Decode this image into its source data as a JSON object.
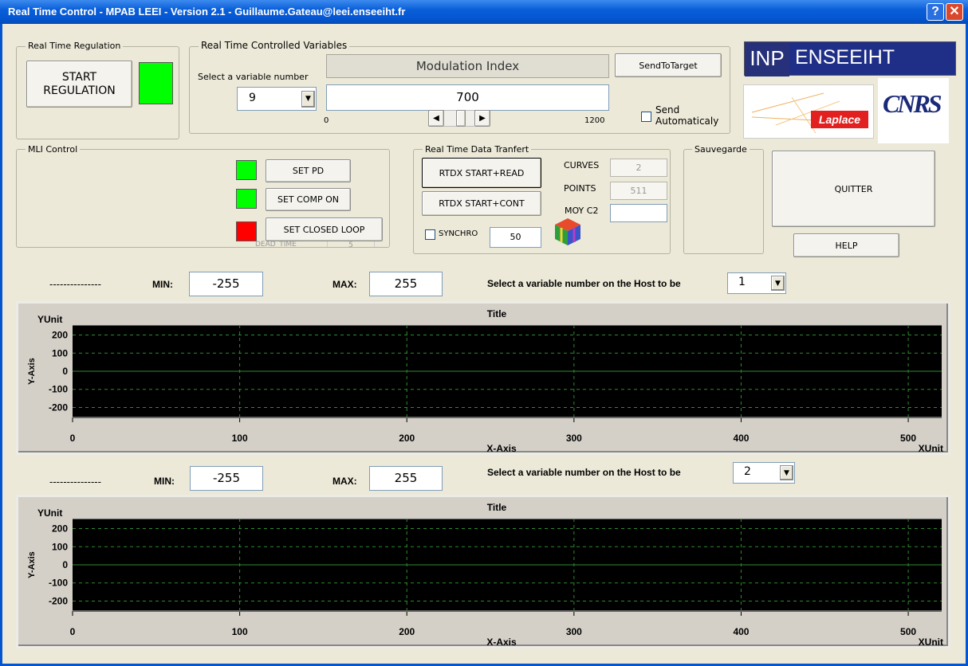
{
  "window": {
    "title": "Real Time Control - MPAB LEEI - Version 2.1 - Guillaume.Gateau@leei.enseeiht.fr",
    "help_glyph": "?",
    "close_glyph": "✕"
  },
  "regulation": {
    "group_title": "Real Time Regulation",
    "start_button": "START\nREGULATION",
    "led_color": "#00ff00"
  },
  "controlled": {
    "group_title": "Real Time Controlled Variables",
    "select_label": "Select a variable number",
    "variable_number": "9",
    "variable_name": "Modulation Index",
    "value": "700",
    "send_button": "SendToTarget",
    "slider_min": "0",
    "slider_max": "1200",
    "slider_value": 700,
    "auto_send_label": "Send\nAutomaticaly",
    "auto_send_checked": false
  },
  "logos": {
    "inp": "INP",
    "enseeiht": "ENSEEIHT",
    "laplace": "Laplace",
    "cnrs": "CNRS"
  },
  "mli": {
    "group_title": "MLI Control",
    "set_pd": "SET PD",
    "set_comp": "SET COMP ON",
    "set_closed": "SET CLOSED LOOP",
    "hidden_label": "DEAD_TIME",
    "hidden_value": "5",
    "led_pd": "#00ff00",
    "led_comp": "#00ff00",
    "led_closed": "#ff0000"
  },
  "rtdx": {
    "group_title": "Real Time Data Tranfert",
    "read_button": "RTDX START+READ",
    "cont_button": "RTDX START+CONT",
    "synchro_label": "SYNCHRO",
    "synchro_checked": false,
    "synchro_value": "50",
    "curves_label": "CURVES",
    "curves_value": "2",
    "points_label": "POINTS",
    "points_value": "511",
    "moy_label": "MOY C2",
    "moy_value": ""
  },
  "save": {
    "group_title": "Sauvegarde"
  },
  "quit_button": "QUITTER",
  "help_button": "HELP",
  "scope1": {
    "dashes": "---------------",
    "min_label": "MIN:",
    "min_value": "-255",
    "max_label": "MAX:",
    "max_value": "255",
    "select_label": "Select a variable number on the Host to be",
    "variable": "1"
  },
  "scope2": {
    "dashes": "---------------",
    "min_label": "MIN:",
    "min_value": "-255",
    "max_label": "MAX:",
    "max_value": "255",
    "select_label": "Select a variable number on the Host to be",
    "variable": "2"
  },
  "chart_data": [
    {
      "type": "line",
      "title": "Title",
      "xlabel": "X-Axis",
      "ylabel": "Y-Axis",
      "x_unit": "XUnit",
      "y_unit": "YUnit",
      "xlim": [
        0,
        520
      ],
      "ylim": [
        -255,
        255
      ],
      "x_ticks": [
        0,
        100,
        200,
        300,
        400,
        500
      ],
      "y_ticks": [
        200,
        100,
        0,
        -100,
        -200
      ],
      "grid": true,
      "series": [],
      "colors": {
        "background": "#000000",
        "grid": "#2e8b2e",
        "zero_line": "#2e8b2e"
      }
    },
    {
      "type": "line",
      "title": "Title",
      "xlabel": "X-Axis",
      "ylabel": "Y-Axis",
      "x_unit": "XUnit",
      "y_unit": "YUnit",
      "xlim": [
        0,
        520
      ],
      "ylim": [
        -255,
        255
      ],
      "x_ticks": [
        0,
        100,
        200,
        300,
        400,
        500
      ],
      "y_ticks": [
        200,
        100,
        0,
        -100,
        -200
      ],
      "grid": true,
      "series": [],
      "colors": {
        "background": "#000000",
        "grid": "#2e8b2e",
        "zero_line": "#2e8b2e"
      }
    }
  ]
}
